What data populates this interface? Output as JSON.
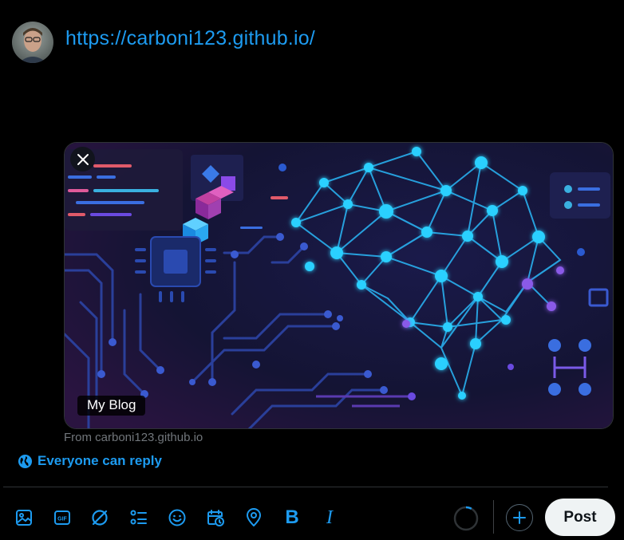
{
  "composer": {
    "avatar_alt": "avatar",
    "text": "https://carboni123.github.io/"
  },
  "card": {
    "label": "My Blog",
    "source": "From carboni123.github.io",
    "close_icon": "close-icon",
    "image_subject": "ai-brain-circuit-illustration"
  },
  "reply_setting": {
    "icon": "globe-icon",
    "label": "Everyone can reply"
  },
  "toolbar": {
    "icons": [
      "media-icon",
      "gif-icon",
      "grok-icon",
      "poll-icon",
      "emoji-icon",
      "schedule-icon",
      "location-icon",
      "bold-icon",
      "italic-icon"
    ],
    "bold_glyph": "B",
    "italic_glyph": "I",
    "gif_glyph": "GIF",
    "add_icon": "plus-icon",
    "post_label": "Post"
  },
  "colors": {
    "accent": "#1d9bf0",
    "background": "#000000",
    "border": "#2f3336",
    "muted": "#71767b",
    "post_bg": "#eff3f4"
  },
  "char_progress": 0.08
}
